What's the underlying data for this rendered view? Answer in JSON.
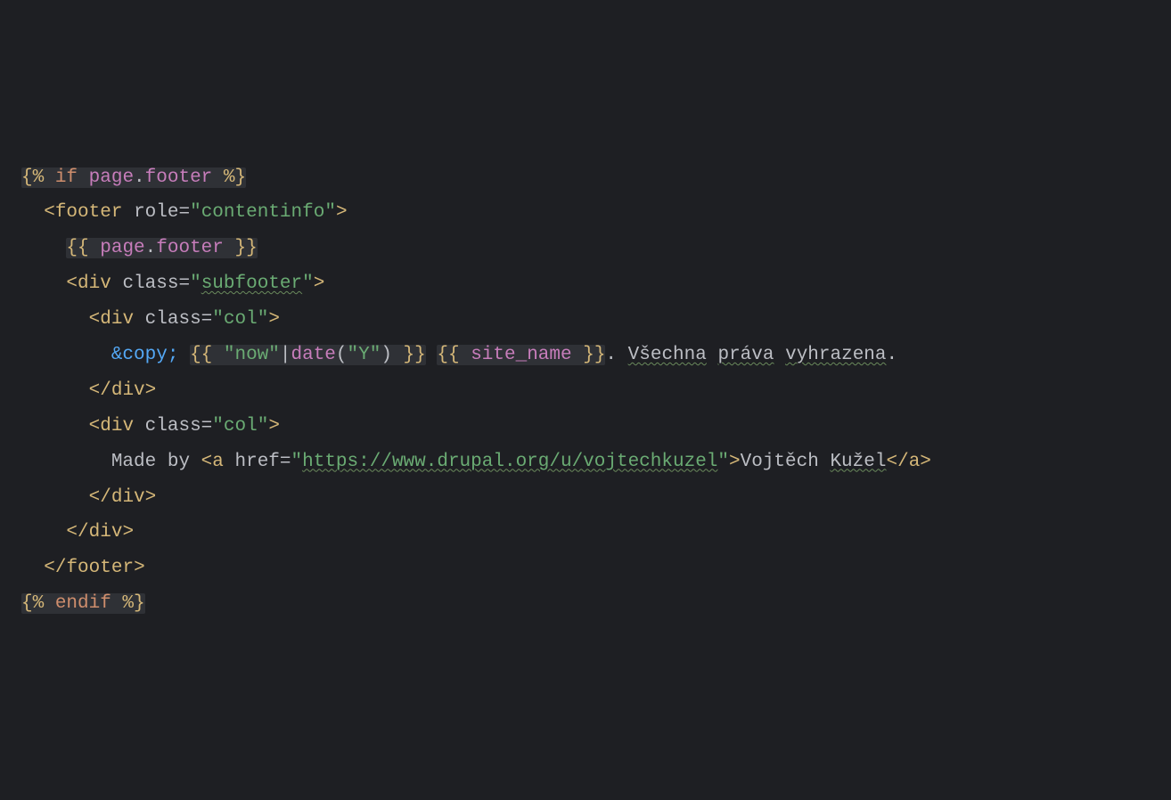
{
  "lines": {
    "l1": {
      "open": "{% ",
      "kw": "if",
      "expr": " page",
      "dot": ".",
      "prop": "footer ",
      "close": "%}"
    },
    "l2": {
      "lt": "<",
      "tag": "footer",
      "sp": " ",
      "attr": "role",
      "eq": "=",
      "q1": "\"",
      "val": "contentinfo",
      "q2": "\"",
      "gt": ">"
    },
    "l3": {
      "open": "{{ ",
      "expr": "page",
      "dot": ".",
      "prop": "footer",
      "close": " }}"
    },
    "l4": {
      "lt": "<",
      "tag": "div",
      "sp": " ",
      "attr": "class",
      "eq": "=",
      "q1": "\"",
      "val": "subfooter",
      "q2": "\"",
      "gt": ">"
    },
    "l5": {
      "lt": "<",
      "tag": "div",
      "sp": " ",
      "attr": "class",
      "eq": "=",
      "q1": "\"",
      "val": "col",
      "q2": "\"",
      "gt": ">"
    },
    "l6": {
      "entity": "&copy;",
      "sp1": " ",
      "twig1_open": "{{ ",
      "twig1_str": "\"now\"",
      "twig1_pipe": "|",
      "twig1_fn": "date",
      "twig1_paren_o": "(",
      "twig1_arg": "\"Y\"",
      "twig1_paren_c": ")",
      "twig1_close": " }}",
      "sp2": " ",
      "twig2_open": "{{ ",
      "twig2_var": "site_name",
      "twig2_close": " }}",
      "text": ". ",
      "w1": "Všechna",
      "s1": " ",
      "w2": "práva",
      "s2": " ",
      "w3": "vyhrazena",
      "dot": "."
    },
    "l7": {
      "lt": "</",
      "tag": "div",
      "gt": ">"
    },
    "l8": {
      "lt": "<",
      "tag": "div",
      "sp": " ",
      "attr": "class",
      "eq": "=",
      "q1": "\"",
      "val": "col",
      "q2": "\"",
      "gt": ">"
    },
    "l9": {
      "text1": "Made by ",
      "lt": "<",
      "tag": "a",
      "sp": " ",
      "attr": "href",
      "eq": "=",
      "q1": "\"",
      "val": "https://www.drupal.org/u/vojtechkuzel",
      "q2": "\"",
      "gt": ">",
      "linktext1": "Vojtěch ",
      "linktext2": "Kužel",
      "clt": "</",
      "ctag": "a",
      "cgt": ">"
    },
    "l10": {
      "lt": "</",
      "tag": "div",
      "gt": ">"
    },
    "l11": {
      "lt": "</",
      "tag": "div",
      "gt": ">"
    },
    "l12": {
      "lt": "</",
      "tag": "footer",
      "gt": ">"
    },
    "l13": {
      "open": "{% ",
      "kw": "endif",
      "close": " %}"
    }
  }
}
